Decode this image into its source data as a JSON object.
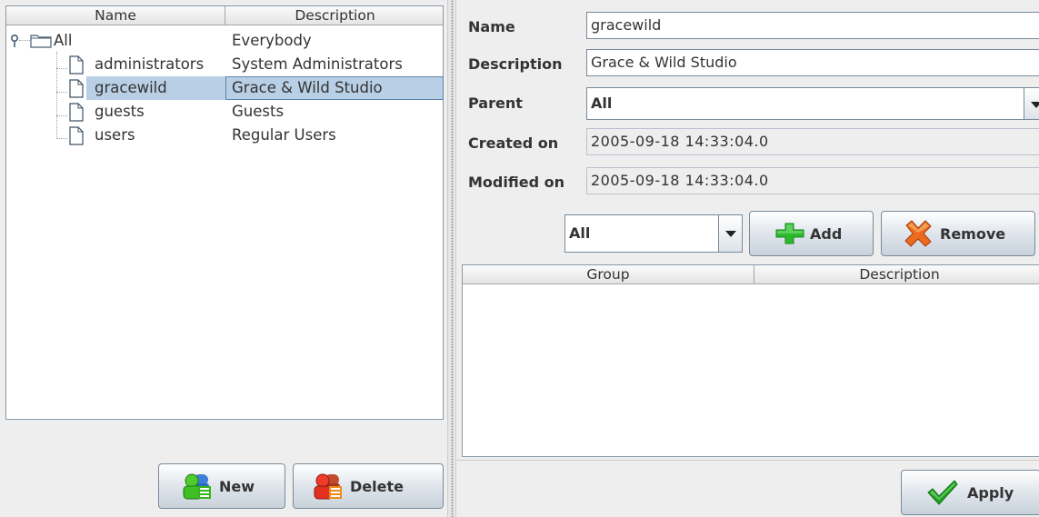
{
  "tree_table": {
    "columns": [
      "Name",
      "Description"
    ],
    "rows": [
      {
        "name": "All",
        "description": "Everybody",
        "icon": "folder-icon",
        "level": 0,
        "selected": false
      },
      {
        "name": "administrators",
        "description": "System Administrators",
        "icon": "document-icon",
        "level": 1,
        "selected": false
      },
      {
        "name": "gracewild",
        "description": "Grace & Wild Studio",
        "icon": "document-icon",
        "level": 1,
        "selected": true
      },
      {
        "name": "guests",
        "description": "Guests",
        "icon": "document-icon",
        "level": 1,
        "selected": false
      },
      {
        "name": "users",
        "description": "Regular Users",
        "icon": "document-icon",
        "level": 1,
        "selected": false
      }
    ]
  },
  "left_buttons": {
    "new_label": "New",
    "delete_label": "Delete"
  },
  "form": {
    "name_label": "Name",
    "name_value": "gracewild",
    "description_label": "Description",
    "description_value": "Grace & Wild Studio",
    "parent_label": "Parent",
    "parent_value": "All",
    "created_label": "Created on",
    "created_value": "2005-09-18 14:33:04.0",
    "modified_label": "Modified on",
    "modified_value": "2005-09-18 14:33:04.0"
  },
  "group_controls": {
    "group_select_value": "All",
    "add_label": "Add",
    "remove_label": "Remove"
  },
  "group_table": {
    "columns": [
      "Group",
      "Description"
    ],
    "rows": []
  },
  "apply_label": "Apply",
  "colors": {
    "selection": "#b8cfe5",
    "add_icon": "#2db82d",
    "remove_icon": "#e0501c",
    "apply_icon": "#1fa51f"
  }
}
